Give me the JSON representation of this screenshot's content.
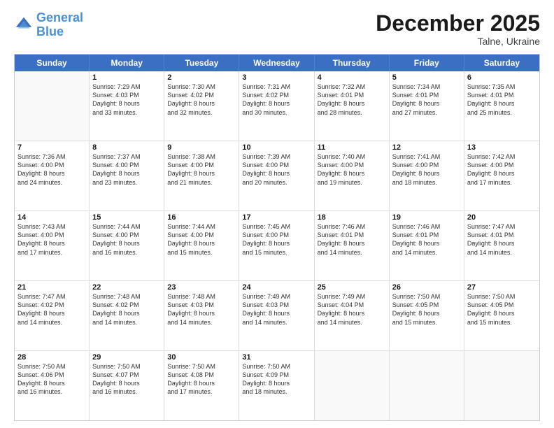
{
  "header": {
    "logo_general": "General",
    "logo_blue": "Blue",
    "month": "December 2025",
    "location": "Talne, Ukraine"
  },
  "days_of_week": [
    "Sunday",
    "Monday",
    "Tuesday",
    "Wednesday",
    "Thursday",
    "Friday",
    "Saturday"
  ],
  "weeks": [
    [
      {
        "day": "",
        "info": [],
        "empty": true
      },
      {
        "day": "1",
        "info": [
          "Sunrise: 7:29 AM",
          "Sunset: 4:03 PM",
          "Daylight: 8 hours",
          "and 33 minutes."
        ]
      },
      {
        "day": "2",
        "info": [
          "Sunrise: 7:30 AM",
          "Sunset: 4:02 PM",
          "Daylight: 8 hours",
          "and 32 minutes."
        ]
      },
      {
        "day": "3",
        "info": [
          "Sunrise: 7:31 AM",
          "Sunset: 4:02 PM",
          "Daylight: 8 hours",
          "and 30 minutes."
        ]
      },
      {
        "day": "4",
        "info": [
          "Sunrise: 7:32 AM",
          "Sunset: 4:01 PM",
          "Daylight: 8 hours",
          "and 28 minutes."
        ]
      },
      {
        "day": "5",
        "info": [
          "Sunrise: 7:34 AM",
          "Sunset: 4:01 PM",
          "Daylight: 8 hours",
          "and 27 minutes."
        ]
      },
      {
        "day": "6",
        "info": [
          "Sunrise: 7:35 AM",
          "Sunset: 4:01 PM",
          "Daylight: 8 hours",
          "and 25 minutes."
        ]
      }
    ],
    [
      {
        "day": "7",
        "info": [
          "Sunrise: 7:36 AM",
          "Sunset: 4:00 PM",
          "Daylight: 8 hours",
          "and 24 minutes."
        ]
      },
      {
        "day": "8",
        "info": [
          "Sunrise: 7:37 AM",
          "Sunset: 4:00 PM",
          "Daylight: 8 hours",
          "and 23 minutes."
        ]
      },
      {
        "day": "9",
        "info": [
          "Sunrise: 7:38 AM",
          "Sunset: 4:00 PM",
          "Daylight: 8 hours",
          "and 21 minutes."
        ]
      },
      {
        "day": "10",
        "info": [
          "Sunrise: 7:39 AM",
          "Sunset: 4:00 PM",
          "Daylight: 8 hours",
          "and 20 minutes."
        ]
      },
      {
        "day": "11",
        "info": [
          "Sunrise: 7:40 AM",
          "Sunset: 4:00 PM",
          "Daylight: 8 hours",
          "and 19 minutes."
        ]
      },
      {
        "day": "12",
        "info": [
          "Sunrise: 7:41 AM",
          "Sunset: 4:00 PM",
          "Daylight: 8 hours",
          "and 18 minutes."
        ]
      },
      {
        "day": "13",
        "info": [
          "Sunrise: 7:42 AM",
          "Sunset: 4:00 PM",
          "Daylight: 8 hours",
          "and 17 minutes."
        ]
      }
    ],
    [
      {
        "day": "14",
        "info": [
          "Sunrise: 7:43 AM",
          "Sunset: 4:00 PM",
          "Daylight: 8 hours",
          "and 17 minutes."
        ]
      },
      {
        "day": "15",
        "info": [
          "Sunrise: 7:44 AM",
          "Sunset: 4:00 PM",
          "Daylight: 8 hours",
          "and 16 minutes."
        ]
      },
      {
        "day": "16",
        "info": [
          "Sunrise: 7:44 AM",
          "Sunset: 4:00 PM",
          "Daylight: 8 hours",
          "and 15 minutes."
        ]
      },
      {
        "day": "17",
        "info": [
          "Sunrise: 7:45 AM",
          "Sunset: 4:00 PM",
          "Daylight: 8 hours",
          "and 15 minutes."
        ]
      },
      {
        "day": "18",
        "info": [
          "Sunrise: 7:46 AM",
          "Sunset: 4:01 PM",
          "Daylight: 8 hours",
          "and 14 minutes."
        ]
      },
      {
        "day": "19",
        "info": [
          "Sunrise: 7:46 AM",
          "Sunset: 4:01 PM",
          "Daylight: 8 hours",
          "and 14 minutes."
        ]
      },
      {
        "day": "20",
        "info": [
          "Sunrise: 7:47 AM",
          "Sunset: 4:01 PM",
          "Daylight: 8 hours",
          "and 14 minutes."
        ]
      }
    ],
    [
      {
        "day": "21",
        "info": [
          "Sunrise: 7:47 AM",
          "Sunset: 4:02 PM",
          "Daylight: 8 hours",
          "and 14 minutes."
        ]
      },
      {
        "day": "22",
        "info": [
          "Sunrise: 7:48 AM",
          "Sunset: 4:02 PM",
          "Daylight: 8 hours",
          "and 14 minutes."
        ]
      },
      {
        "day": "23",
        "info": [
          "Sunrise: 7:48 AM",
          "Sunset: 4:03 PM",
          "Daylight: 8 hours",
          "and 14 minutes."
        ]
      },
      {
        "day": "24",
        "info": [
          "Sunrise: 7:49 AM",
          "Sunset: 4:03 PM",
          "Daylight: 8 hours",
          "and 14 minutes."
        ]
      },
      {
        "day": "25",
        "info": [
          "Sunrise: 7:49 AM",
          "Sunset: 4:04 PM",
          "Daylight: 8 hours",
          "and 14 minutes."
        ]
      },
      {
        "day": "26",
        "info": [
          "Sunrise: 7:50 AM",
          "Sunset: 4:05 PM",
          "Daylight: 8 hours",
          "and 15 minutes."
        ]
      },
      {
        "day": "27",
        "info": [
          "Sunrise: 7:50 AM",
          "Sunset: 4:05 PM",
          "Daylight: 8 hours",
          "and 15 minutes."
        ]
      }
    ],
    [
      {
        "day": "28",
        "info": [
          "Sunrise: 7:50 AM",
          "Sunset: 4:06 PM",
          "Daylight: 8 hours",
          "and 16 minutes."
        ]
      },
      {
        "day": "29",
        "info": [
          "Sunrise: 7:50 AM",
          "Sunset: 4:07 PM",
          "Daylight: 8 hours",
          "and 16 minutes."
        ]
      },
      {
        "day": "30",
        "info": [
          "Sunrise: 7:50 AM",
          "Sunset: 4:08 PM",
          "Daylight: 8 hours",
          "and 17 minutes."
        ]
      },
      {
        "day": "31",
        "info": [
          "Sunrise: 7:50 AM",
          "Sunset: 4:09 PM",
          "Daylight: 8 hours",
          "and 18 minutes."
        ]
      },
      {
        "day": "",
        "info": [],
        "empty": true
      },
      {
        "day": "",
        "info": [],
        "empty": true
      },
      {
        "day": "",
        "info": [],
        "empty": true
      }
    ]
  ]
}
